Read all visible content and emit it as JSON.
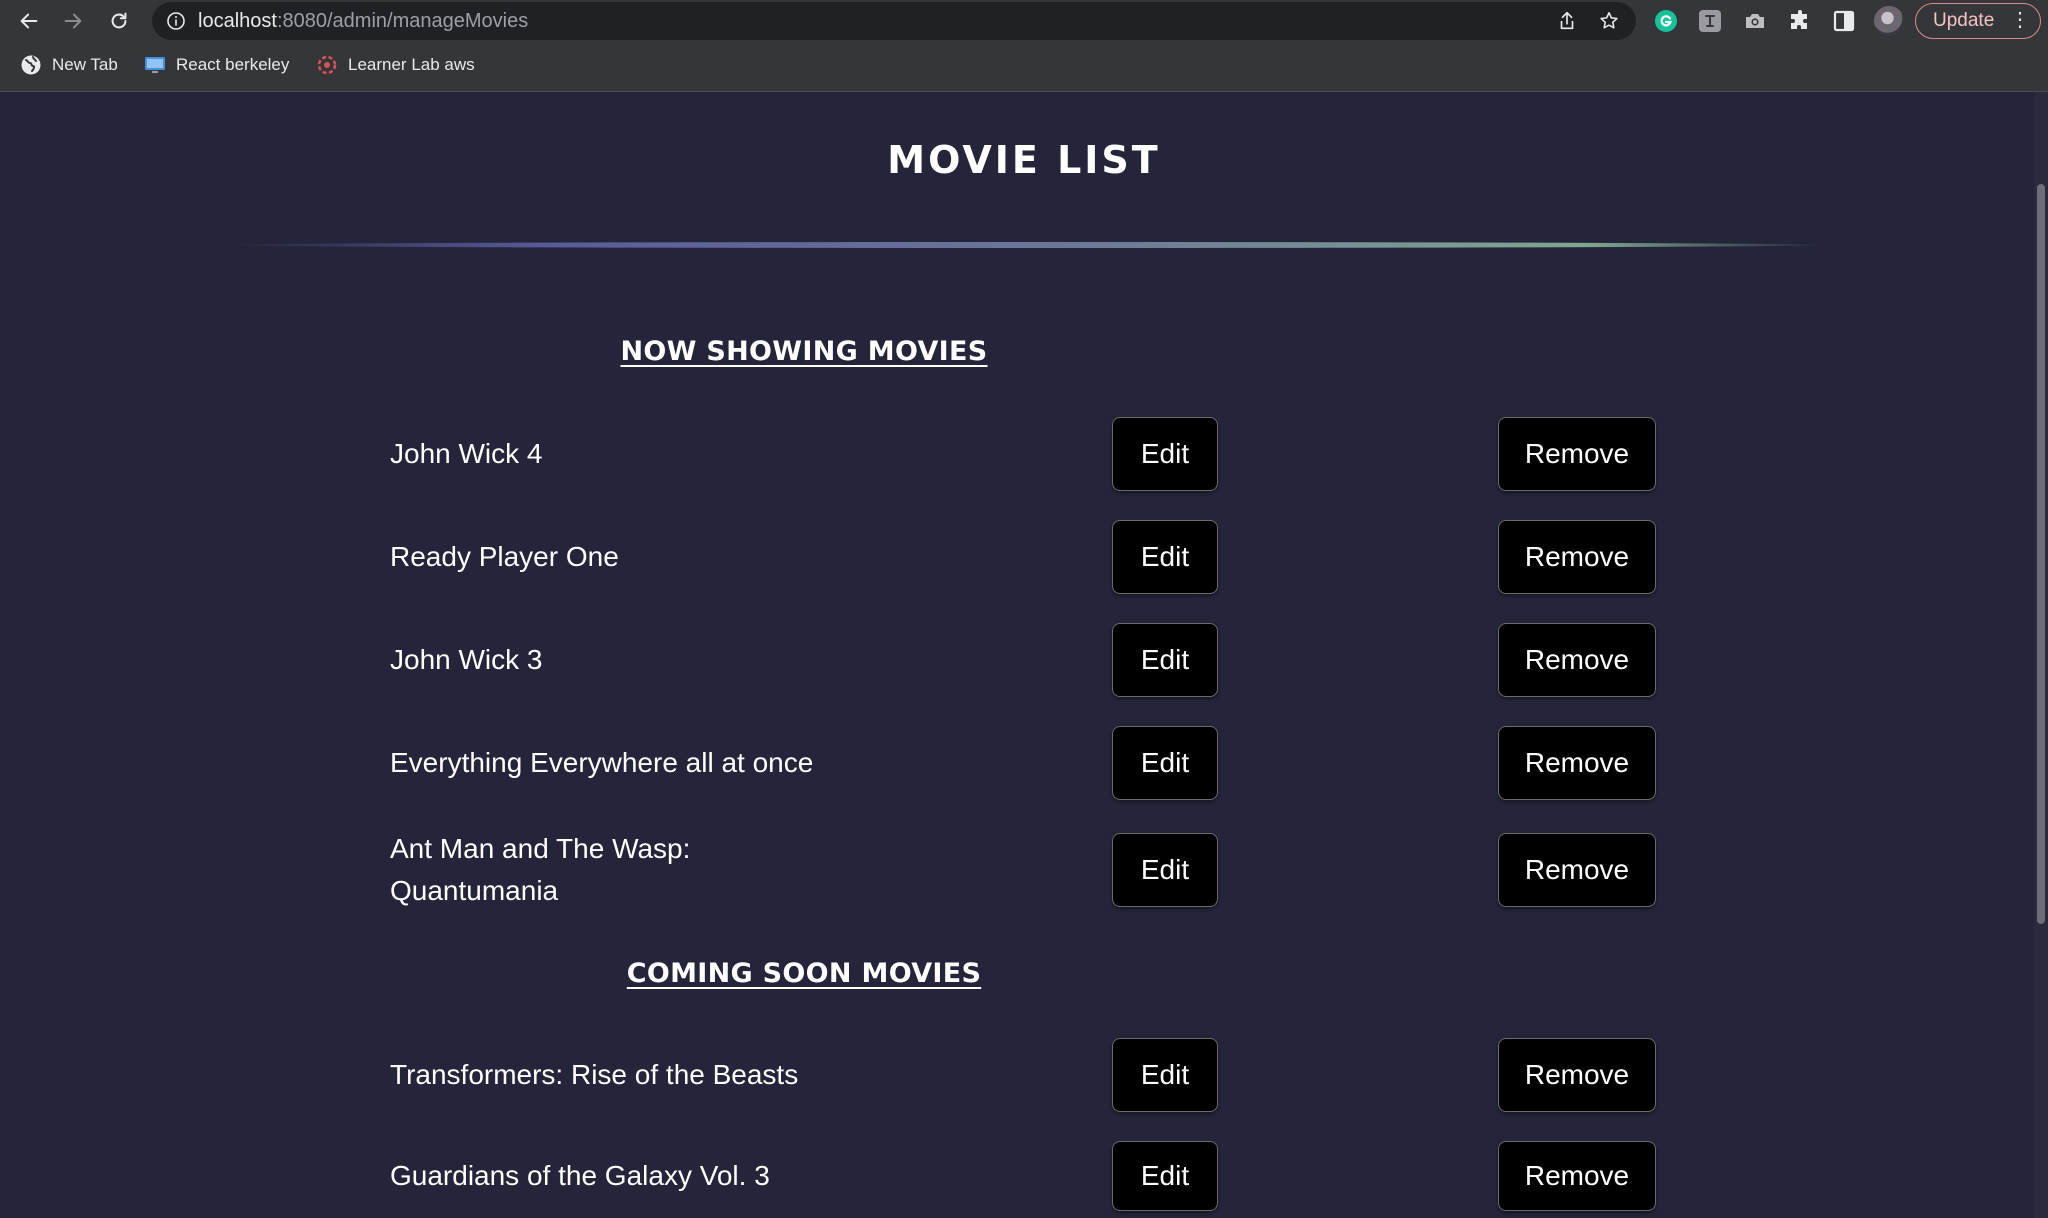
{
  "browser": {
    "url_host": "localhost",
    "url_path": ":8080/admin/manageMovies",
    "update_label": "Update",
    "menu_glyph": "⋮",
    "bookmarks": [
      {
        "label": "New Tab",
        "icon": "globe-icon"
      },
      {
        "label": "React berkeley",
        "icon": "monitor-icon"
      },
      {
        "label": "Learner Lab aws",
        "icon": "aws-lab-icon"
      }
    ],
    "extensions": [
      "grammarly-icon",
      "translate-extension-icon",
      "camera-icon",
      "puzzle-icon",
      "side-panel-icon"
    ],
    "colors": {
      "grammarly": "#15c39a",
      "update_border": "#d88b8b"
    }
  },
  "page": {
    "title": "MOVIE LIST",
    "now_showing": {
      "heading": "NOW SHOWING MOVIES",
      "movies": [
        {
          "name": "John Wick 4"
        },
        {
          "name": "Ready Player One"
        },
        {
          "name": "John Wick 3"
        },
        {
          "name": "Everything Everywhere all at once"
        },
        {
          "name": "Ant Man and The Wasp: Quantumania"
        }
      ]
    },
    "coming_soon": {
      "heading": "COMING SOON MOVIES",
      "movies": [
        {
          "name": "Transformers: Rise of the Beasts"
        },
        {
          "name": "Guardians of the Galaxy Vol. 3"
        }
      ]
    },
    "edit_label": "Edit",
    "remove_label": "Remove"
  }
}
